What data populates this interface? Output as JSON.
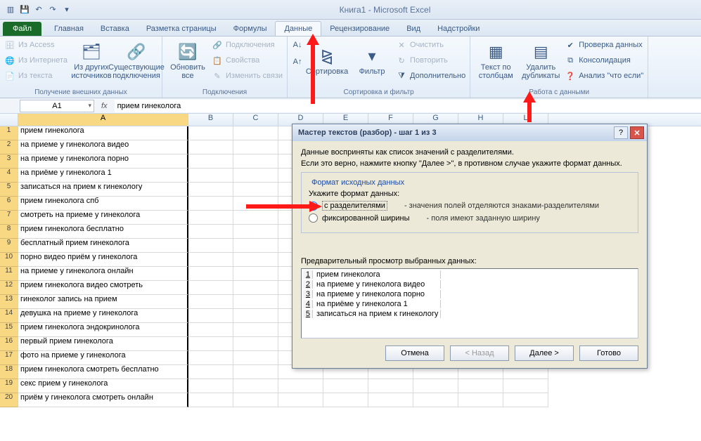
{
  "title": "Книга1 - Microsoft Excel",
  "tabs": {
    "file": "Файл",
    "home": "Главная",
    "insert": "Вставка",
    "layout": "Разметка страницы",
    "formulas": "Формулы",
    "data": "Данные",
    "review": "Рецензирование",
    "view": "Вид",
    "addins": "Надстройки"
  },
  "ribbon": {
    "ext_group": "Получение внешних данных",
    "from_access": "Из Access",
    "from_web": "Из Интернета",
    "from_text": "Из текста",
    "from_other": "Из других источников",
    "existing_conn": "Существующие подключения",
    "conn_group": "Подключения",
    "refresh_all": "Обновить все",
    "connections": "Подключения",
    "properties": "Свойства",
    "edit_links": "Изменить связи",
    "sort_group": "Сортировка и фильтр",
    "sort": "Сортировка",
    "filter": "Фильтр",
    "clear": "Очистить",
    "reapply": "Повторить",
    "advanced": "Дополнительно",
    "data_tools_group": "Работа с данными",
    "text_to_cols": "Текст по столбцам",
    "remove_dup": "Удалить дубликаты",
    "data_val": "Проверка данных",
    "consolidate": "Консолидация",
    "what_if": "Анализ \"что если\""
  },
  "namebox": "A1",
  "formula": "прием гинеколога",
  "columns": [
    "A",
    "B",
    "C",
    "D",
    "E",
    "F",
    "G",
    "H",
    "L"
  ],
  "rows": [
    "прием гинеколога",
    "на приеме у гинеколога видео",
    "на приеме у гинеколога порно",
    "на приёме у гинеколога 1",
    "записаться на прием к гинекологу",
    "прием гинеколога спб",
    "смотреть на приеме у гинеколога",
    "прием гинеколога бесплатно",
    "бесплатный прием гинеколога",
    "порно видео приём у гинеколога",
    "на приеме у гинеколога онлайн",
    "прием гинеколога видео смотреть",
    "гинеколог запись на прием",
    "девушка на приеме у гинеколога",
    "прием гинеколога эндокринолога",
    "первый прием гинеколога",
    "фото на приеме у гинеколога",
    "прием гинеколога смотреть бесплатно",
    "секс прием у гинеколога",
    "приём у гинеколога смотреть онлайн"
  ],
  "dialog": {
    "title": "Мастер текстов (разбор) - шаг 1 из 3",
    "intro1": "Данные восприняты как список значений с разделителями.",
    "intro2": "Если это верно, нажмите кнопку \"Далее >\", в противном случае укажите формат данных.",
    "src_format_legend": "Формат исходных данных",
    "specify_format": "Укажите формат данных:",
    "radio_delim": "с разделителями",
    "radio_delim_desc": "- значения полей отделяются знаками-разделителями",
    "radio_fixed": "фиксированной ширины",
    "radio_fixed_desc": "- поля имеют заданную ширину",
    "preview_label": "Предварительный просмотр выбранных данных:",
    "preview": [
      "прием гинеколога",
      "на приеме у гинеколога видео",
      "на приеме у гинеколога порно",
      "на приёме у гинеколога 1",
      "записаться на прием к гинекологу"
    ],
    "btn_cancel": "Отмена",
    "btn_back": "< Назад",
    "btn_next": "Далее >",
    "btn_finish": "Готово"
  }
}
